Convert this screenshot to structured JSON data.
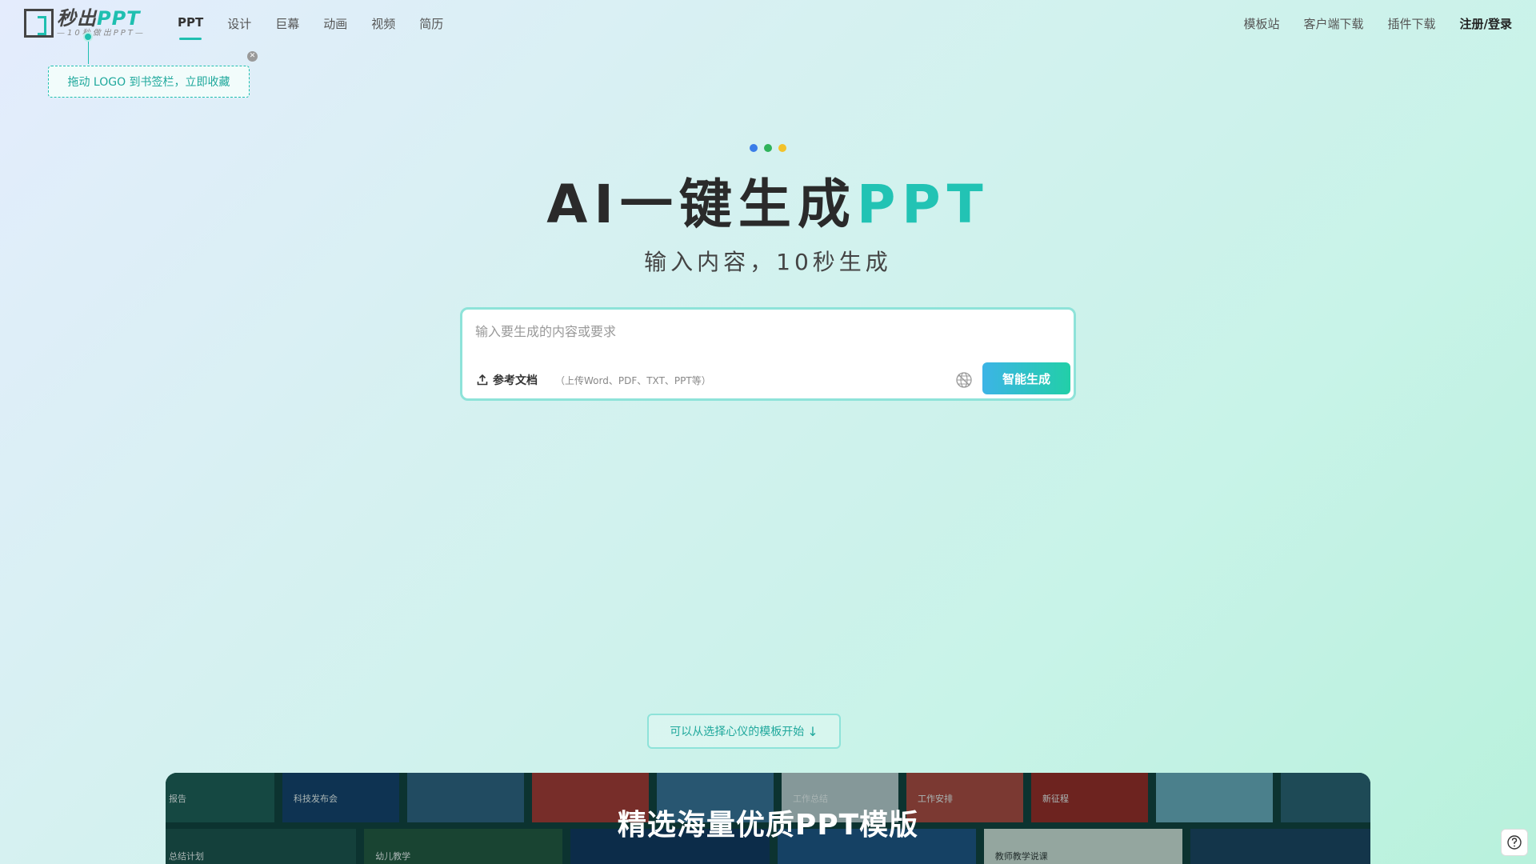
{
  "logo": {
    "main_prefix": "秒出",
    "main_brand": "PPT",
    "sub": "—10秒做出PPT—"
  },
  "nav": {
    "items": [
      "PPT",
      "设计",
      "巨幕",
      "动画",
      "视频",
      "简历"
    ],
    "active": "PPT"
  },
  "right_nav": {
    "templates": "模板站",
    "client_download": "客户端下载",
    "plugin_download": "插件下载",
    "login": "注册/登录"
  },
  "tooltip": {
    "text": "拖动 LOGO 到书签栏，立即收藏"
  },
  "hero": {
    "title_main": "AI一键生成",
    "title_accent": "PPT",
    "subtitle": "输入内容，10秒生成"
  },
  "input_box": {
    "placeholder": "输入要生成的内容或要求",
    "value": "",
    "upload_label": "参考文档",
    "upload_hint": "（上传Word、PDF、TXT、PPT等）",
    "generate_label": "智能生成"
  },
  "template_hint": "可以从选择心仪的模板开始",
  "banner": {
    "title": "精选海量优质PPT模版",
    "tiles": [
      {
        "label": "报告",
        "color": "#1d5a52"
      },
      {
        "label": "科技发布会",
        "color": "#123a6a"
      },
      {
        "label": "",
        "color": "#2f5f82"
      },
      {
        "label": "",
        "color": "#b3312c"
      },
      {
        "label": "",
        "color": "#3a6f9a"
      },
      {
        "label": "工作总结",
        "color": "#c8d4d8"
      },
      {
        "label": "工作安排",
        "color": "#b8433a"
      },
      {
        "label": "新征程",
        "color": "#a3211d"
      },
      {
        "label": "",
        "color": "#6fb0c4"
      },
      {
        "label": "",
        "color": "#2a5c70"
      },
      {
        "label": "",
        "color": "#c9dbe0"
      }
    ],
    "lower_tiles": [
      {
        "label": "总结计划",
        "color": "#1b4d47"
      },
      {
        "label": "幼儿教学",
        "color": "#23543a"
      },
      {
        "label": "",
        "color": "#0e2f5c"
      },
      {
        "label": "",
        "color": "#1c4f86"
      },
      {
        "label": "教师教学说课",
        "color": "#dfeae0"
      },
      {
        "label": "",
        "color": "#1a3d5e"
      }
    ]
  },
  "colors": {
    "accent": "#1fbfb0",
    "dot_blue": "#3a7de8",
    "dot_green": "#2fb35a",
    "dot_yellow": "#f3c22a"
  },
  "icons": {
    "upload": "upload-icon",
    "globe": "globe-icon",
    "close": "close-icon",
    "help": "question-circle-icon",
    "arrow": "arrow-down-icon"
  }
}
